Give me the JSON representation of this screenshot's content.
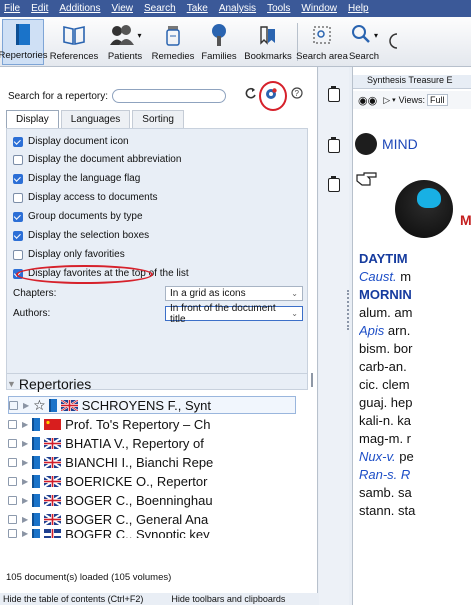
{
  "menu": [
    "File",
    "Edit",
    "Additions",
    "View",
    "Search",
    "Take",
    "Analysis",
    "Tools",
    "Window",
    "Help"
  ],
  "ribbon": {
    "repertories": "Repertories",
    "references": "References",
    "patients": "Patients",
    "remedies": "Remedies",
    "families": "Families",
    "bookmarks": "Bookmarks",
    "search_area": "Search area",
    "search": "Search"
  },
  "left": {
    "search_label": "Search for a repertory:",
    "search_value": "",
    "tabs": [
      "Display",
      "Languages",
      "Sorting"
    ],
    "active_tab": "Display",
    "options": [
      {
        "label": "Display document icon",
        "checked": true
      },
      {
        "label": "Display the document abbreviation",
        "checked": false
      },
      {
        "label": "Display the language flag",
        "checked": true
      },
      {
        "label": "Display access to documents",
        "checked": false
      },
      {
        "label": "Group documents by type",
        "checked": true
      },
      {
        "label": "Display the selection boxes",
        "checked": true
      },
      {
        "label": "Display only favorities",
        "checked": false
      },
      {
        "label": "Display favorites at the top of the list",
        "checked": true
      }
    ],
    "chapters_label": "Chapters:",
    "chapters_value": "In a grid as icons",
    "authors_label": "Authors:",
    "authors_value": "In front of the document title",
    "tree_title": "Repertories",
    "tree_rows": [
      {
        "text": "SCHROYENS F., Synt",
        "flag": "uk",
        "star": true
      },
      {
        "text": "Prof. To's Repertory – Ch",
        "flag": "cn",
        "star": false
      },
      {
        "text": "BHATIA V., Repertory of",
        "flag": "uk",
        "star": false
      },
      {
        "text": "BIANCHI I., Bianchi Repe",
        "flag": "uk",
        "star": false
      },
      {
        "text": "BOERICKE O., Repertor",
        "flag": "uk",
        "star": false
      },
      {
        "text": "BOGER C., Boenninghau",
        "flag": "uk",
        "star": false
      },
      {
        "text": "BOGER C., General Ana",
        "flag": "uk",
        "star": false
      },
      {
        "text": "BOGER C., Synoptic key",
        "flag": "uk",
        "star": false
      }
    ],
    "status": "105 document(s) loaded (105 volumes)",
    "bottom_hide_toc": "Hide the table of contents (Ctrl+F2)",
    "bottom_hide_toolbars": "Hide toolbars and clipboards"
  },
  "doc": {
    "tab_title": "Synthesis Treasure E",
    "views_label": "Views:",
    "views_value": "Full",
    "mind": "MIND",
    "big_initial": "M",
    "lines": [
      {
        "text": "DAYTIM",
        "style": "head"
      },
      {
        "text": "Caust.",
        "rest": " m",
        "style": "it"
      },
      {
        "text": "MORNIN",
        "style": "head"
      },
      {
        "text": "alum. am",
        "style": "plain"
      },
      {
        "text": "Apis",
        "rest": " arn.",
        "style": "it"
      },
      {
        "text": "bism. bor",
        "style": "plain"
      },
      {
        "text": "carb-an.",
        "style": "plain"
      },
      {
        "text": "cic. clem",
        "style": "plain"
      },
      {
        "text": "guaj. hep",
        "style": "plain"
      },
      {
        "text": "kali-n. ka",
        "style": "plain"
      },
      {
        "text": "mag-m. r",
        "style": "plain"
      },
      {
        "text": "Nux-v.",
        "rest": " pe",
        "style": "it"
      },
      {
        "text": "Ran-s. R",
        "style": "it"
      },
      {
        "text": "samb. sa",
        "style": "plain"
      },
      {
        "text": "stann. sta",
        "style": "plain"
      }
    ]
  }
}
